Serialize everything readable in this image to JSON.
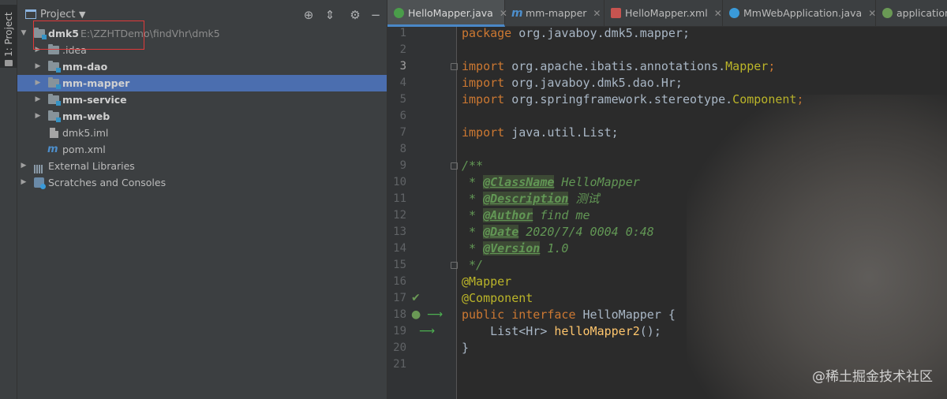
{
  "sidebar_strip": {
    "label": "1: Project"
  },
  "project": {
    "title": "Project",
    "tree": [
      {
        "label": "dmk5",
        "path": "E:\\ZZHTDemo\\findVhr\\dmk5"
      },
      {
        "label": ".idea"
      },
      {
        "label": "mm-dao"
      },
      {
        "label": "mm-mapper"
      },
      {
        "label": "mm-service"
      },
      {
        "label": "mm-web"
      },
      {
        "label": "dmk5.iml"
      },
      {
        "label": "pom.xml"
      },
      {
        "label": "External Libraries"
      },
      {
        "label": "Scratches and Consoles"
      }
    ]
  },
  "tabs": [
    {
      "label": "HelloMapper.java",
      "icon_color": "#4a9d4a"
    },
    {
      "label": "mm-mapper",
      "icon_color": "#4d8fcc"
    },
    {
      "label": "HelloMapper.xml",
      "icon_color": "#c75450"
    },
    {
      "label": "MmWebApplication.java",
      "icon_color": "#3a9ad9"
    },
    {
      "label": "application",
      "icon_color": "#6a9955"
    }
  ],
  "editor": {
    "line_numbers": [
      "1",
      "2",
      "3",
      "4",
      "5",
      "6",
      "7",
      "8",
      "9",
      "10",
      "11",
      "12",
      "13",
      "14",
      "15",
      "16",
      "17",
      "18",
      "19",
      "20",
      "21"
    ],
    "code": {
      "l1_kw": "package",
      "l1_rest": " org.javaboy.dmk5.mapper;",
      "l3_kw": "import",
      "l3_rest": " org.apache.ibatis.annotations.",
      "l3_cls": "Mapper",
      "l3_end": ";",
      "l4_kw": "import",
      "l4_rest": " org.javaboy.dmk5.dao.Hr;",
      "l5_kw": "import",
      "l5_rest": " org.springframework.stereotype.",
      "l5_cls": "Component",
      "l5_end": ";",
      "l7_kw": "import",
      "l7_rest": " java.util.List;",
      "l9": "/**",
      "l10_star": " * ",
      "l10_tag": "@ClassName",
      "l10_val": " HelloMapper",
      "l11_star": " * ",
      "l11_tag": "@Description",
      "l11_val": " 测试",
      "l12_star": " * ",
      "l12_tag": "@Author",
      "l12_val": " find me",
      "l13_star": " * ",
      "l13_tag": "@Date",
      "l13_val": " 2020/7/4 0004 0:48",
      "l14_star": " * ",
      "l14_tag": "@Version",
      "l14_val": " 1.0",
      "l15": " */",
      "l16": "@Mapper",
      "l17": "@Component",
      "l18_kw": "public interface",
      "l18_name": " HelloMapper {",
      "l19_type": "    List<Hr> ",
      "l19_fn": "helloMapper2",
      "l19_end": "();",
      "l20": "}"
    }
  },
  "watermark": "@稀土掘金技术社区"
}
